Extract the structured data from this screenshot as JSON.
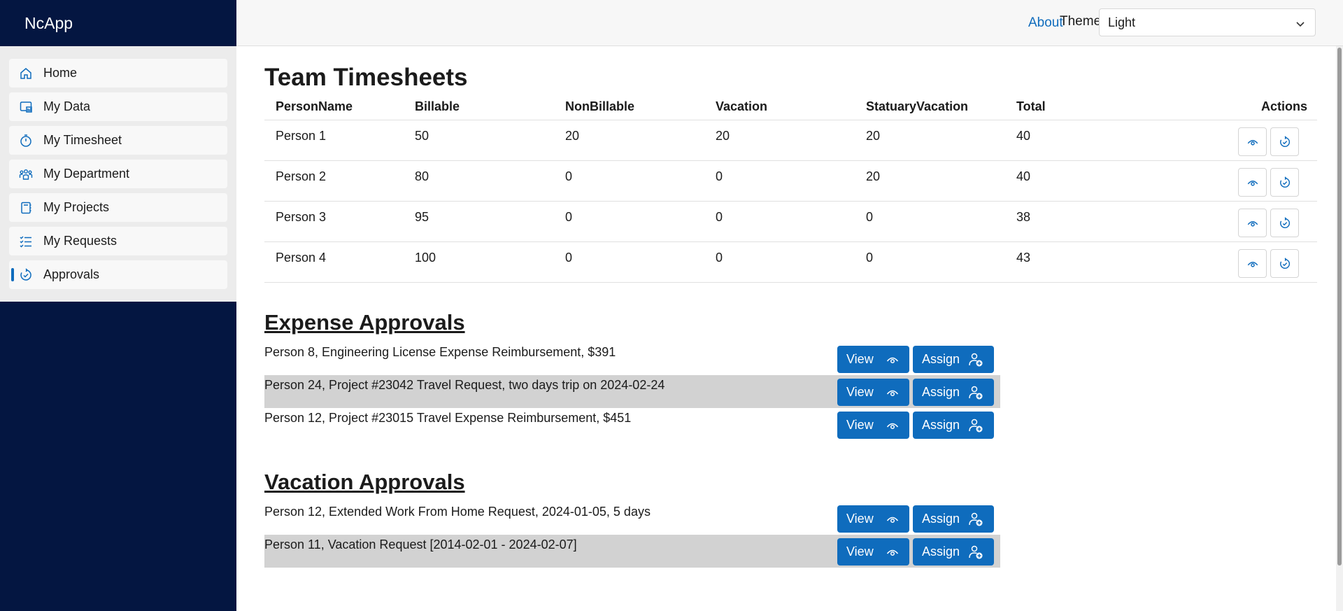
{
  "app": {
    "brand": "NcApp"
  },
  "sidebar": {
    "items": [
      {
        "label": "Home",
        "icon": "home-icon"
      },
      {
        "label": "My Data",
        "icon": "data-icon"
      },
      {
        "label": "My Timesheet",
        "icon": "timer-icon"
      },
      {
        "label": "My Department",
        "icon": "people-icon"
      },
      {
        "label": "My Projects",
        "icon": "notebook-icon"
      },
      {
        "label": "My Requests",
        "icon": "task-list-icon"
      },
      {
        "label": "Approvals",
        "icon": "approval-icon",
        "active": true
      }
    ]
  },
  "topbar": {
    "about": "About",
    "theme_label": "Theme",
    "theme_value": "Light"
  },
  "timesheets": {
    "title": "Team Timesheets",
    "headers": {
      "name": "PersonName",
      "billable": "Billable",
      "nonbillable": "NonBillable",
      "vacation": "Vacation",
      "statuary": "StatuaryVacation",
      "total": "Total",
      "actions": "Actions"
    },
    "rows": [
      {
        "name": "Person 1",
        "billable": "50",
        "nonbillable": "20",
        "vacation": "20",
        "statuary": "20",
        "total": "40"
      },
      {
        "name": "Person 2",
        "billable": "80",
        "nonbillable": "0",
        "vacation": "0",
        "statuary": "20",
        "total": "40"
      },
      {
        "name": "Person 3",
        "billable": "95",
        "nonbillable": "0",
        "vacation": "0",
        "statuary": "0",
        "total": "38"
      },
      {
        "name": "Person 4",
        "billable": "100",
        "nonbillable": "0",
        "vacation": "0",
        "statuary": "0",
        "total": "43"
      }
    ]
  },
  "expense": {
    "title": "Expense Approvals",
    "items": [
      "Person 8, Engineering License Expense Reimbursement, $391",
      "Person 24, Project #23042 Travel Request, two days trip on 2024-02-24",
      "Person 12, Project #23015 Travel Expense Reimbursement, $451"
    ]
  },
  "vacation": {
    "title": "Vacation Approvals",
    "items": [
      "Person 12, Extended Work From Home Request, 2024-01-05, 5 days",
      "Person 11, Vacation Request [2014-02-01 - 2024-02-07]"
    ]
  },
  "buttons": {
    "view": "View",
    "assign": "Assign"
  },
  "colors": {
    "sidebar_bg": "#041641",
    "accent": "#0f6cbd",
    "alt_row": "#d2d2d2"
  }
}
